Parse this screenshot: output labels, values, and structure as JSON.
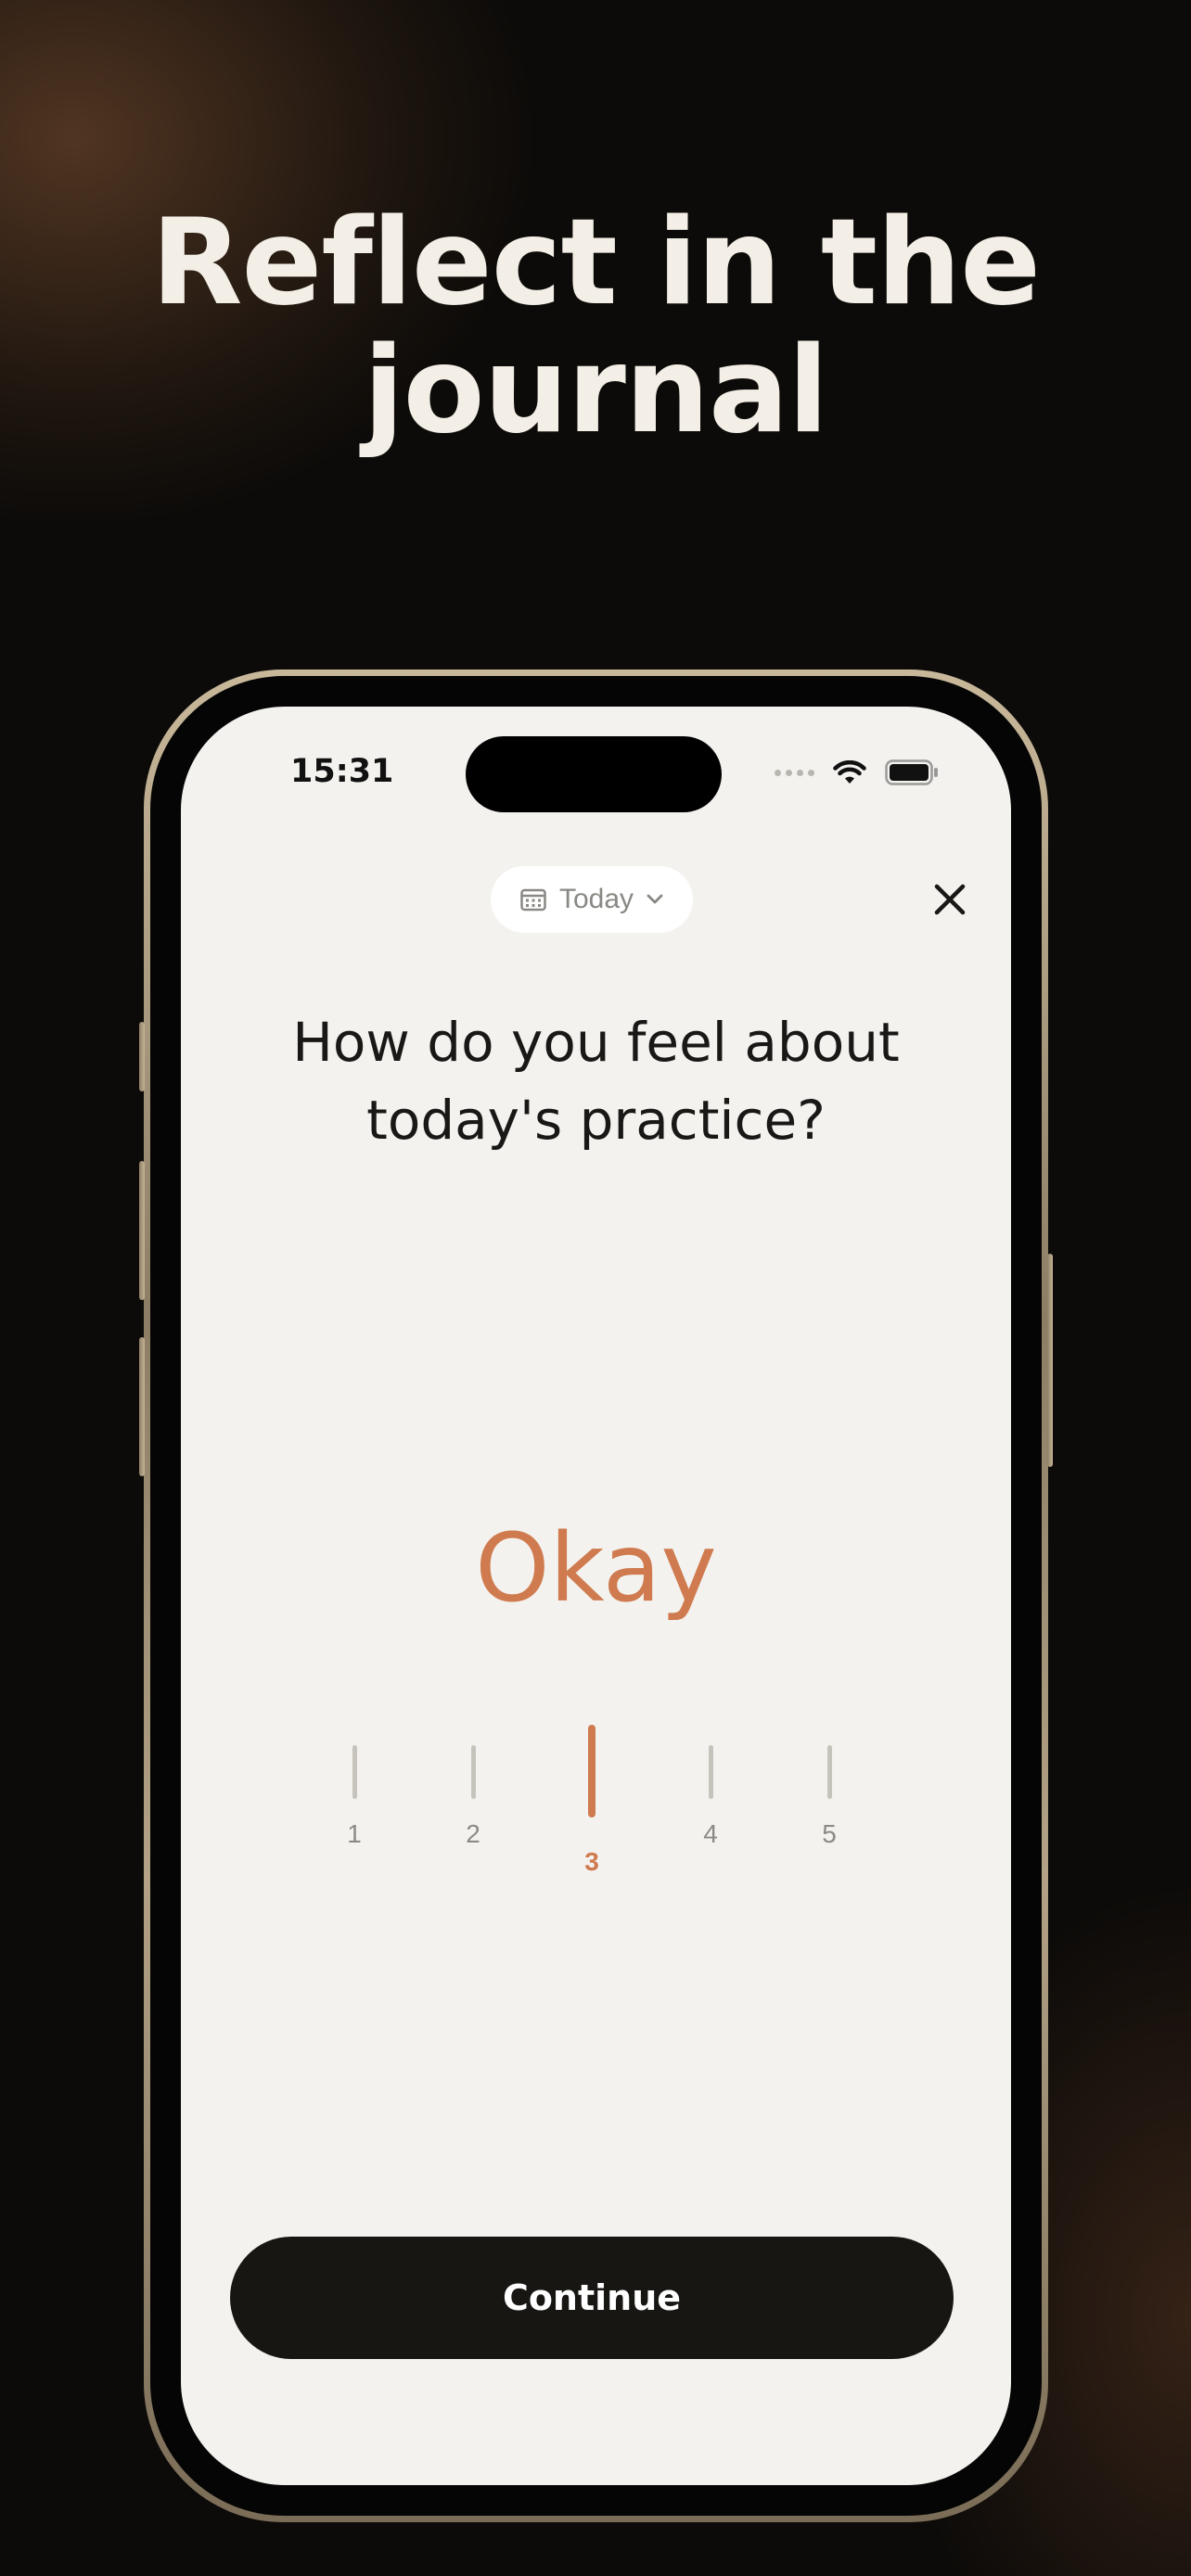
{
  "headline": {
    "line1": "Reflect in the",
    "line2": "journal"
  },
  "status_bar": {
    "time": "15:31",
    "icons": [
      "cellular-signal-icon",
      "wifi-icon",
      "battery-icon"
    ]
  },
  "header": {
    "date_selector_label": "Today",
    "date_icon": "calendar-icon",
    "dropdown_icon": "chevron-down-icon",
    "close_icon": "close-icon"
  },
  "question": {
    "line1": "How do you feel about",
    "line2": "today's practice?"
  },
  "mood": {
    "label": "Okay",
    "scale": [
      "1",
      "2",
      "3",
      "4",
      "5"
    ],
    "selected": "3"
  },
  "continue_label": "Continue",
  "colors": {
    "accent": "#cf7b4f",
    "screen_background": "#f4f2ee",
    "button_background": "#171613",
    "headline_text": "#f3efe6"
  }
}
